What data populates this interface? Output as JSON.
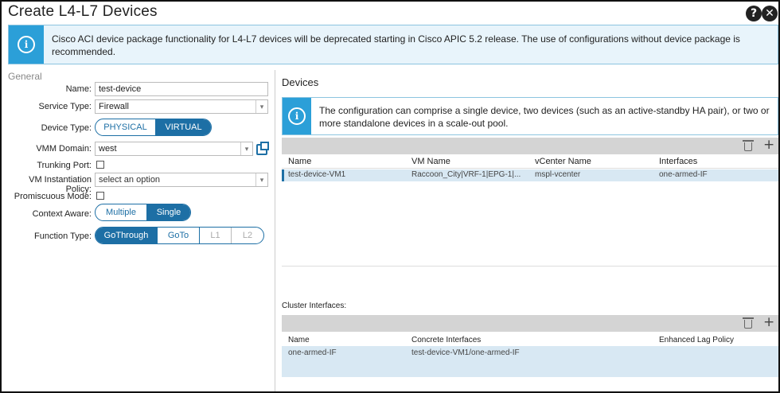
{
  "window": {
    "title": "Create L4-L7 Devices",
    "help_icon": "question-icon",
    "close_icon": "close-icon"
  },
  "banner": {
    "text": "Cisco ACI device package functionality for L4-L7 devices will be deprecated starting in Cisco APIC 5.2 release. The use of configurations without device package is recommended.",
    "icon": "info-icon"
  },
  "general": {
    "section_label": "General",
    "name": {
      "label": "Name:",
      "value": "test-device"
    },
    "service_type": {
      "label": "Service Type:",
      "value": "Firewall"
    },
    "device_type": {
      "label": "Device Type:",
      "options": [
        "PHYSICAL",
        "VIRTUAL"
      ],
      "selected": "VIRTUAL"
    },
    "vmm_domain": {
      "label": "VMM Domain:",
      "value": "west"
    },
    "trunking_port": {
      "label": "Trunking Port:",
      "checked": false
    },
    "vm_instantiation_policy": {
      "label": "VM Instantiation Policy:",
      "placeholder": "select an option"
    },
    "promiscuous_mode": {
      "label": "Promiscuous Mode:",
      "checked": false
    },
    "context_aware": {
      "label": "Context Aware:",
      "options": [
        "Multiple",
        "Single"
      ],
      "selected": "Single"
    },
    "function_type": {
      "label": "Function Type:",
      "options": [
        "GoThrough",
        "GoTo",
        "L1",
        "L2"
      ],
      "selected": "GoThrough"
    }
  },
  "devices": {
    "title": "Devices",
    "info_text": "The configuration can comprise a single device, two devices (such as an active-standby HA pair), or two or more standalone devices in a scale-out pool.",
    "columns": [
      "Name",
      "VM Name",
      "vCenter Name",
      "Interfaces"
    ],
    "rows": [
      {
        "name": "test-device-VM1",
        "vm_name": "Raccoon_City|VRF-1|EPG-1|...",
        "vcenter": "mspl-vcenter",
        "interfaces": "one-armed-IF"
      }
    ]
  },
  "cluster": {
    "label": "Cluster Interfaces:",
    "columns": [
      "Name",
      "Concrete Interfaces",
      "Enhanced Lag Policy"
    ],
    "rows": [
      {
        "name": "one-armed-IF",
        "concrete": "test-device-VM1/one-armed-IF",
        "lag": ""
      }
    ]
  },
  "colors": {
    "accent": "#1d6fa5",
    "info_blue": "#2b9fd8",
    "selected_row": "#d8e8f3",
    "toolbar_gray": "#d4d4d4"
  }
}
